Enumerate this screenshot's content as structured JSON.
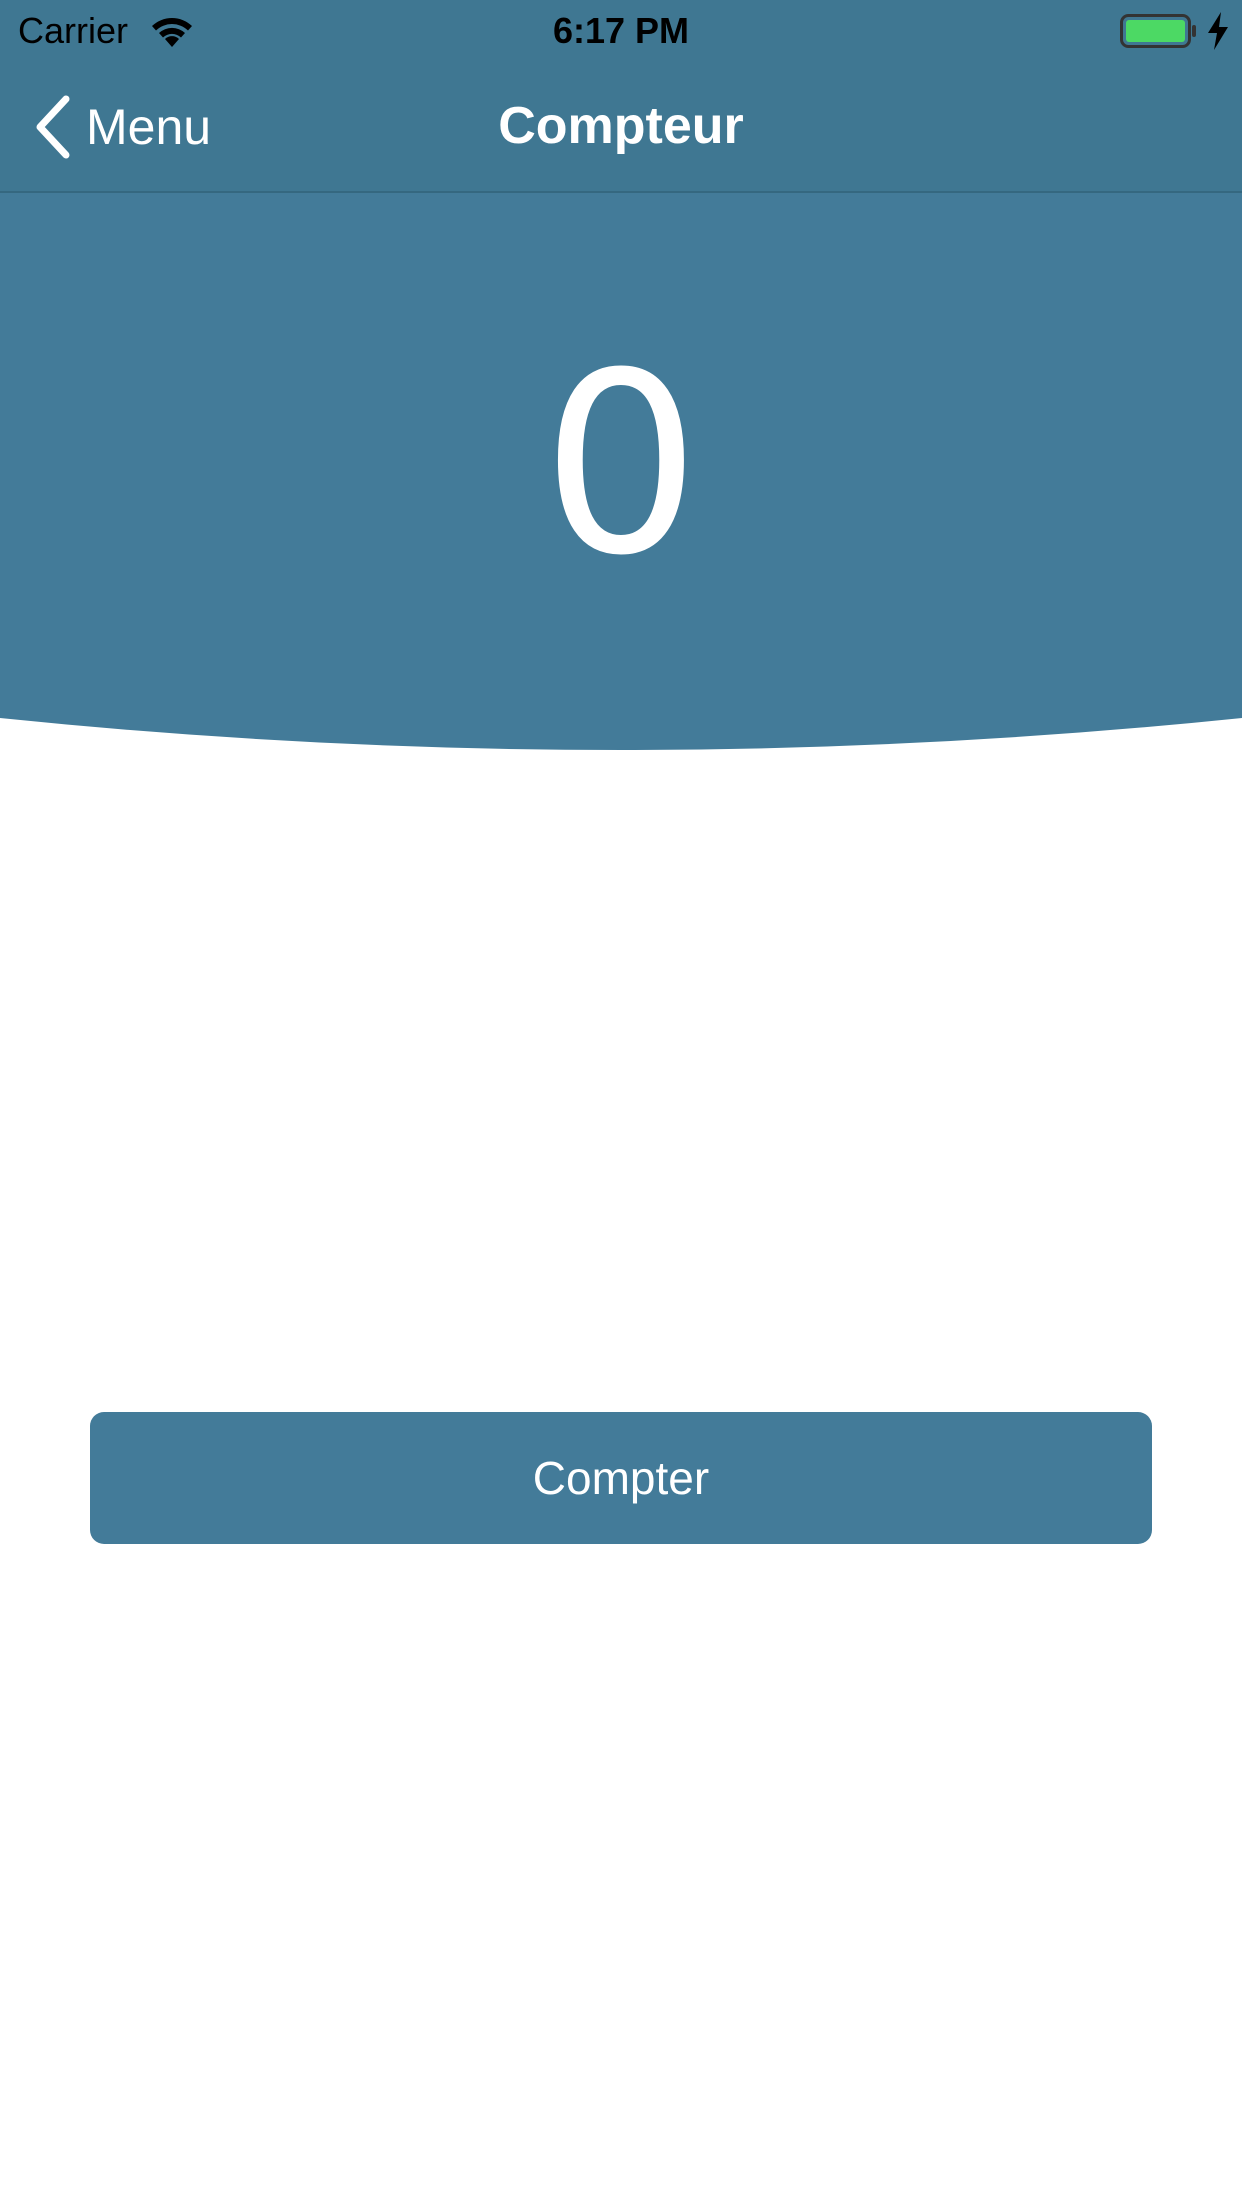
{
  "status_bar": {
    "carrier": "Carrier",
    "time": "6:17 PM",
    "battery_level": 1.0,
    "charging": true
  },
  "nav_bar": {
    "back_label": "Menu",
    "title": "Compteur"
  },
  "counter": {
    "value": "0"
  },
  "actions": {
    "count_button_label": "Compter"
  },
  "icons": {
    "back": "chevron-left-icon",
    "wifi": "wifi-icon",
    "battery": "battery-icon",
    "charging": "bolt-icon"
  },
  "colors": {
    "nav_background": "#3f7792",
    "header_background": "#437b99",
    "button_background": "#437b99",
    "battery_fill": "#4cd964",
    "text_on_primary": "#ffffff",
    "page_background": "#ffffff"
  }
}
